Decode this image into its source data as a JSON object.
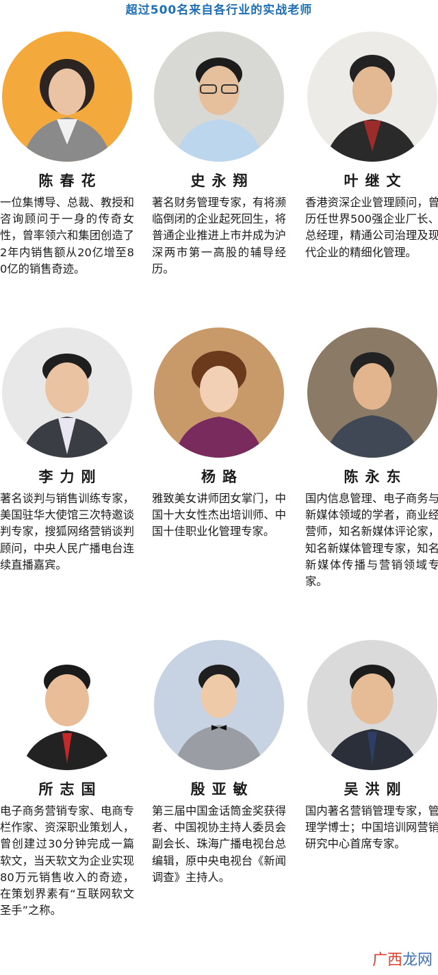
{
  "header": {
    "title": "超过500名来自各行业的实战老师"
  },
  "teachers": [
    {
      "name": "陈春花",
      "bio": "一位集博导、总裁、教授和咨询顾问于一身的传奇女性，曾率领六和集团创造了2年内销售额从20亿增至80亿的销售奇迹。"
    },
    {
      "name": "史永翔",
      "bio": "著名财务管理专家，有将濒临倒闭的企业起死回生，将普通企业推进上市并成为沪深两市第一高股的辅导经历。"
    },
    {
      "name": "叶继文",
      "bio": "香港资深企业管理顾问，曾历任世界500强企业厂长、总经理，精通公司治理及现代企业的精细化管理。"
    },
    {
      "name": "李力刚",
      "bio": "著名谈判与销售训练专家，美国驻华大使馆三次特邀谈判专家，搜狐网络营销谈判顾问，中央人民广播电台连续直播嘉宾。"
    },
    {
      "name": "杨路",
      "bio": "雅致美女讲师团女掌门，中国十大女性杰出培训师、中国十佳职业化管理专家。"
    },
    {
      "name": "陈永东",
      "bio": "国内信息管理、电子商务与新媒体领域的学者，商业经营师，知名新媒体评论家，知名新媒体管理专家，知名新媒体传播与营销领域专家。"
    },
    {
      "name": "所志国",
      "bio": "电子商务营销专家、电商专栏作家、资深职业策划人，曾创建过30分钟完成一篇软文，当天软文为企业实现80万元销售收入的奇迹，在策划界素有“互联网软文圣手”之称。"
    },
    {
      "name": "殷亚敏",
      "bio": "第三届中国金话筒金奖获得者、中国视协主持人委员会副会长、珠海广播电视台总编辑，原中央电视台《新闻调查》主持人。"
    },
    {
      "name": "吴洪刚",
      "bio": "国内著名营销管理专家，管理学博士；中国培训网营销研究中心首席专家。"
    }
  ],
  "watermark": {
    "part1": "广西",
    "part2": "龙网"
  }
}
